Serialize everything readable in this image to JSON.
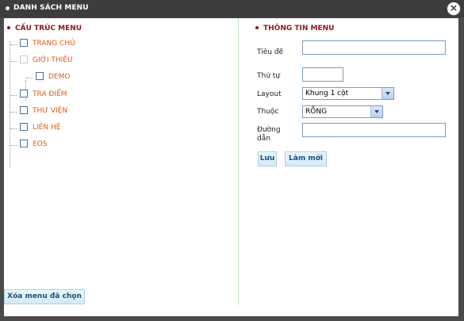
{
  "window": {
    "title": "DANH SÁCH MENU",
    "close_glyph": "×"
  },
  "left": {
    "heading": "CẤU TRÚC MENU",
    "items": [
      {
        "label": "TRANG CHỦ",
        "level": 0,
        "disabled": false
      },
      {
        "label": "GIỚI THIỆU",
        "level": 0,
        "disabled": true
      },
      {
        "label": "DEMO",
        "level": 1,
        "disabled": false
      },
      {
        "label": "TRA ĐIỂM",
        "level": 0,
        "disabled": false
      },
      {
        "label": "THƯ VIỆN",
        "level": 0,
        "disabled": false
      },
      {
        "label": "LIÊN HỆ",
        "level": 0,
        "disabled": false
      },
      {
        "label": "EOS",
        "level": 0,
        "disabled": false
      }
    ],
    "delete_button": "Xóa menu đã chọn"
  },
  "right": {
    "heading": "THÔNG TIN MENU",
    "fields": {
      "title_label": "Tiêu đề",
      "title_value": "",
      "order_label": "Thứ tự",
      "order_value": "",
      "layout_label": "Layout",
      "layout_value": "Khung 1 cột",
      "parent_label": "Thuộc",
      "parent_value": "RỖNG",
      "path_label_1": "Đường",
      "path_label_2": "dẫn",
      "path_value": ""
    },
    "save_button": "Lưu",
    "reset_button": "Làm mới"
  },
  "colors": {
    "heading": "#8b1a1a",
    "tree_label": "#e05a1a",
    "button_text": "#1d4f7a",
    "frame": "#4a4a4a"
  }
}
